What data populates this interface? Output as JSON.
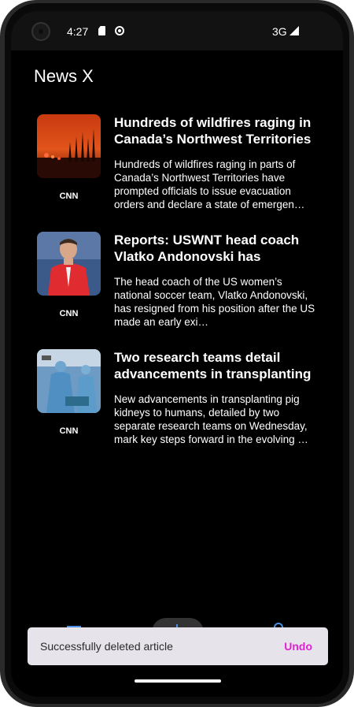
{
  "status_bar": {
    "time": "4:27",
    "network": "3G"
  },
  "app": {
    "title": "News X"
  },
  "articles": [
    {
      "title": "Hundreds of wildfires raging in Canada’s Northwest Territories",
      "description": "Hundreds of wildfires raging in parts of Canada’s Northwest Territories have prompted officials to issue evacuation orders and declare a state of emergen…",
      "source": "CNN",
      "image": "wildfire-photo"
    },
    {
      "title": "Reports: USWNT head coach Vlatko Andonovski has",
      "description": "The head coach of the US women’s national soccer team, Vlatko Andonovski, has resigned from his position after the US  made an early exi…",
      "source": "CNN",
      "image": "coach-photo"
    },
    {
      "title": "Two research teams detail advancements in transplanting",
      "description": "New advancements in transplanting pig kidneys to humans, detailed by two separate research teams on Wednesday, mark key steps forward in the evolving …",
      "source": "CNN",
      "image": "surgery-photo"
    }
  ],
  "snackbar": {
    "message": "Successfully deleted article",
    "action": "Undo"
  },
  "colors": {
    "background": "#000000",
    "accent": "#e31fd5",
    "nav": "#4a90e2",
    "snackbar": "#e6e4ea"
  }
}
